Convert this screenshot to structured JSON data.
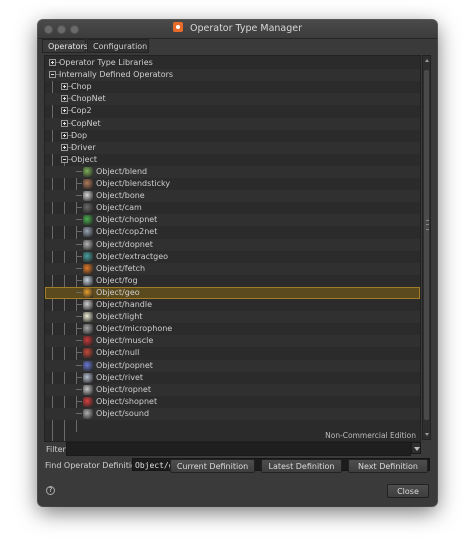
{
  "window": {
    "title": "Operator Type Manager"
  },
  "tabs": [
    "Operators",
    "Configuration"
  ],
  "tree": {
    "rows": [
      {
        "label": "Operator Type Libraries",
        "level": 0,
        "expander": "plus"
      },
      {
        "label": "Internally Defined Operators",
        "level": 0,
        "expander": "minus"
      },
      {
        "label": "Chop",
        "level": 1,
        "expander": "plus"
      },
      {
        "label": "ChopNet",
        "level": 1,
        "expander": "plus"
      },
      {
        "label": "Cop2",
        "level": 1,
        "expander": "plus"
      },
      {
        "label": "CopNet",
        "level": 1,
        "expander": "plus"
      },
      {
        "label": "Dop",
        "level": 1,
        "expander": "plus"
      },
      {
        "label": "Driver",
        "level": 1,
        "expander": "plus"
      },
      {
        "label": "Object",
        "level": 1,
        "expander": "minus"
      },
      {
        "label": "Object/blend",
        "level": 2,
        "icon": "blend-icon",
        "color": "#7fb05a"
      },
      {
        "label": "Object/blendsticky",
        "level": 2,
        "icon": "blendsticky-icon",
        "color": "#b07a5a"
      },
      {
        "label": "Object/bone",
        "level": 2,
        "icon": "bone-icon",
        "color": "#d8d8d8"
      },
      {
        "label": "Object/cam",
        "level": 2,
        "icon": "camera-icon",
        "color": "#6a6a6a"
      },
      {
        "label": "Object/chopnet",
        "level": 2,
        "icon": "chopnet-icon",
        "color": "#4caf50"
      },
      {
        "label": "Object/cop2net",
        "level": 2,
        "icon": "cop2net-icon",
        "color": "#9aa7b5"
      },
      {
        "label": "Object/dopnet",
        "level": 2,
        "icon": "dopnet-icon",
        "color": "#b8b8b8"
      },
      {
        "label": "Object/extractgeo",
        "level": 2,
        "icon": "extractgeo-icon",
        "color": "#4aa0a0"
      },
      {
        "label": "Object/fetch",
        "level": 2,
        "icon": "fetch-icon",
        "color": "#e07a2a"
      },
      {
        "label": "Object/fog",
        "level": 2,
        "icon": "fog-icon",
        "color": "#c8d4e0"
      },
      {
        "label": "Object/geo",
        "level": 2,
        "icon": "geo-icon",
        "color": "#e8a02a",
        "selected": true
      },
      {
        "label": "Object/handle",
        "level": 2,
        "icon": "handle-icon",
        "color": "#d0d0d0"
      },
      {
        "label": "Object/light",
        "level": 2,
        "icon": "light-icon",
        "color": "#f0f0d8"
      },
      {
        "label": "Object/microphone",
        "level": 2,
        "icon": "microphone-icon",
        "color": "#a8a8a8"
      },
      {
        "label": "Object/muscle",
        "level": 2,
        "icon": "muscle-icon",
        "color": "#c83a3a"
      },
      {
        "label": "Object/null",
        "level": 2,
        "icon": "null-icon",
        "color": "#c84a3a"
      },
      {
        "label": "Object/popnet",
        "level": 2,
        "icon": "popnet-icon",
        "color": "#6a7ad0"
      },
      {
        "label": "Object/rivet",
        "level": 2,
        "icon": "rivet-icon",
        "color": "#b8c0d0"
      },
      {
        "label": "Object/ropnet",
        "level": 2,
        "icon": "ropnet-icon",
        "color": "#c8c8c8"
      },
      {
        "label": "Object/shopnet",
        "level": 2,
        "icon": "shopnet-icon",
        "color": "#d84040"
      },
      {
        "label": "Object/sound",
        "level": 2,
        "icon": "sound-icon",
        "color": "#b0b0b0"
      }
    ]
  },
  "watermark": "Non-Commercial Edition",
  "filter": {
    "label": "Filter",
    "value": ""
  },
  "find": {
    "label": "Find Operator Definition",
    "value": "Object/geo"
  },
  "buttons": {
    "current": "Current Definition",
    "latest": "Latest Definition",
    "next": "Next Definition",
    "close": "Close"
  },
  "help_icon": "?"
}
